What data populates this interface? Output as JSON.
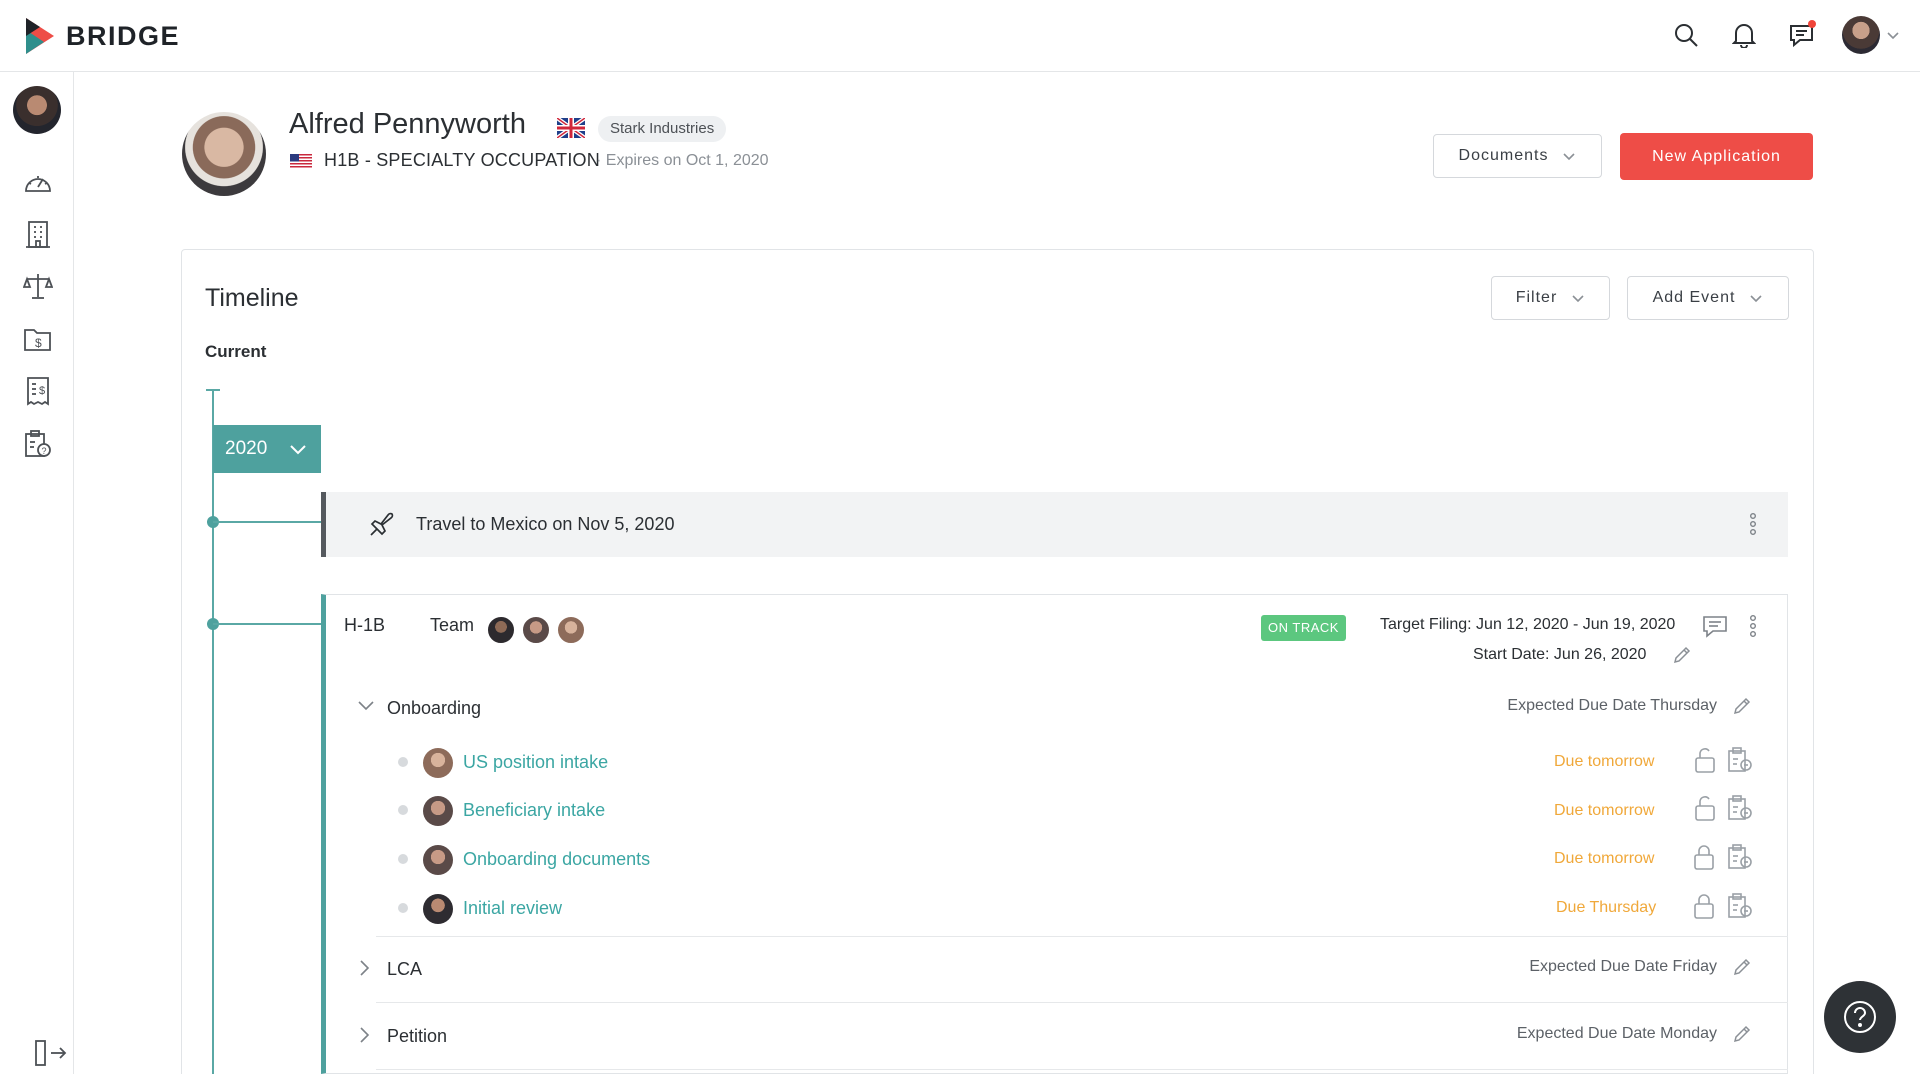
{
  "app": {
    "logo_text": "BRIDGE"
  },
  "profile": {
    "name": "Alfred Pennyworth",
    "company": "Stark Industries",
    "visa_type": "H1B - SPECIALTY OCCUPATION",
    "expiry": "· Expires on Oct 1, 2020"
  },
  "header_actions": {
    "documents_label": "Documents",
    "new_application_label": "New Application"
  },
  "timeline": {
    "title": "Timeline",
    "current_label": "Current",
    "filter_label": "Filter",
    "add_event_label": "Add Event",
    "year": "2020",
    "travel_event": "Travel to Mexico on Nov 5, 2020"
  },
  "case": {
    "label": "H-1B",
    "team_label": "Team",
    "status": "ON TRACK",
    "target_filing": "Target Filing: Jun 12, 2020 - Jun 19, 2020",
    "start_date": "Start Date: Jun 26, 2020",
    "sections": [
      {
        "label": "Onboarding",
        "due": "Expected Due Date Thursday",
        "expanded": true,
        "tasks": [
          {
            "label": "US position intake",
            "due": "Due tomorrow",
            "locked": false
          },
          {
            "label": "Beneficiary intake",
            "due": "Due tomorrow",
            "locked": false
          },
          {
            "label": "Onboarding documents",
            "due": "Due tomorrow",
            "locked": true
          },
          {
            "label": "Initial review",
            "due": "Due Thursday",
            "locked": true
          }
        ]
      },
      {
        "label": "LCA",
        "due": "Expected Due Date Friday",
        "expanded": false
      },
      {
        "label": "Petition",
        "due": "Expected Due Date Monday",
        "expanded": false
      }
    ]
  },
  "colors": {
    "accent_teal": "#4ea19e",
    "primary_red": "#ee4d47",
    "status_green": "#5cc77f",
    "due_orange": "#f0a83a"
  },
  "icons": {
    "top": [
      "search-icon",
      "bell-icon",
      "chat-icon"
    ],
    "sidebar": [
      "dashboard-icon",
      "building-icon",
      "scales-icon",
      "folder-dollar-icon",
      "receipt-icon",
      "clipboard-help-icon",
      "logout-icon"
    ]
  }
}
